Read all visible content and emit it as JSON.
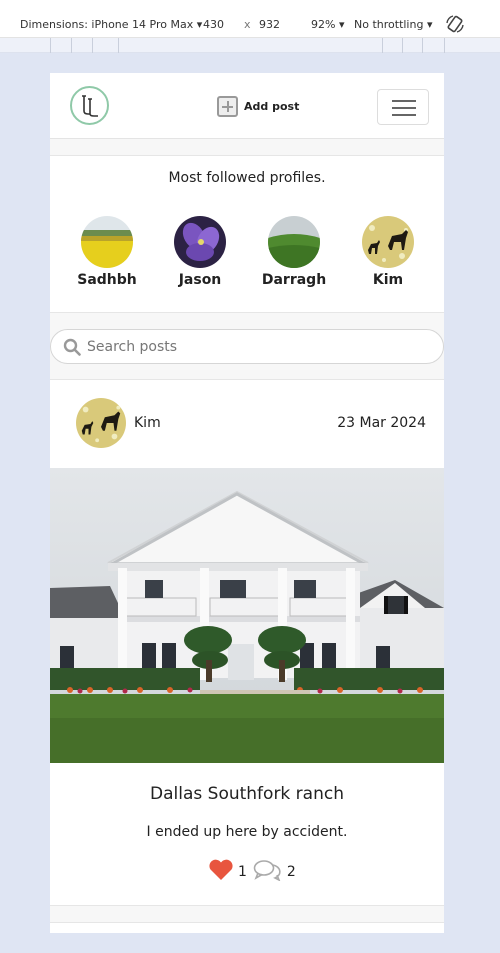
{
  "devtools": {
    "device": "Dimensions: iPhone 14 Pro Max",
    "width": "430",
    "times": "x",
    "height": "932",
    "zoom": "92%",
    "throttling": "No throttling"
  },
  "navbar": {
    "add_post_label": "Add post"
  },
  "profiles": {
    "title": "Most followed profiles.",
    "items": [
      {
        "name": "Sadhbh"
      },
      {
        "name": "Jason"
      },
      {
        "name": "Darragh"
      },
      {
        "name": "Kim"
      }
    ]
  },
  "search": {
    "placeholder": "Search posts"
  },
  "post": {
    "author": "Kim",
    "date": "23 Mar 2024",
    "title": "Dallas Southfork ranch",
    "caption": "I ended up here by accident.",
    "likes": "1",
    "comments": "2"
  },
  "colors": {
    "background": "#dfe5f3",
    "heart": "#e8553e",
    "logo_ring": "#8fc9a8"
  }
}
